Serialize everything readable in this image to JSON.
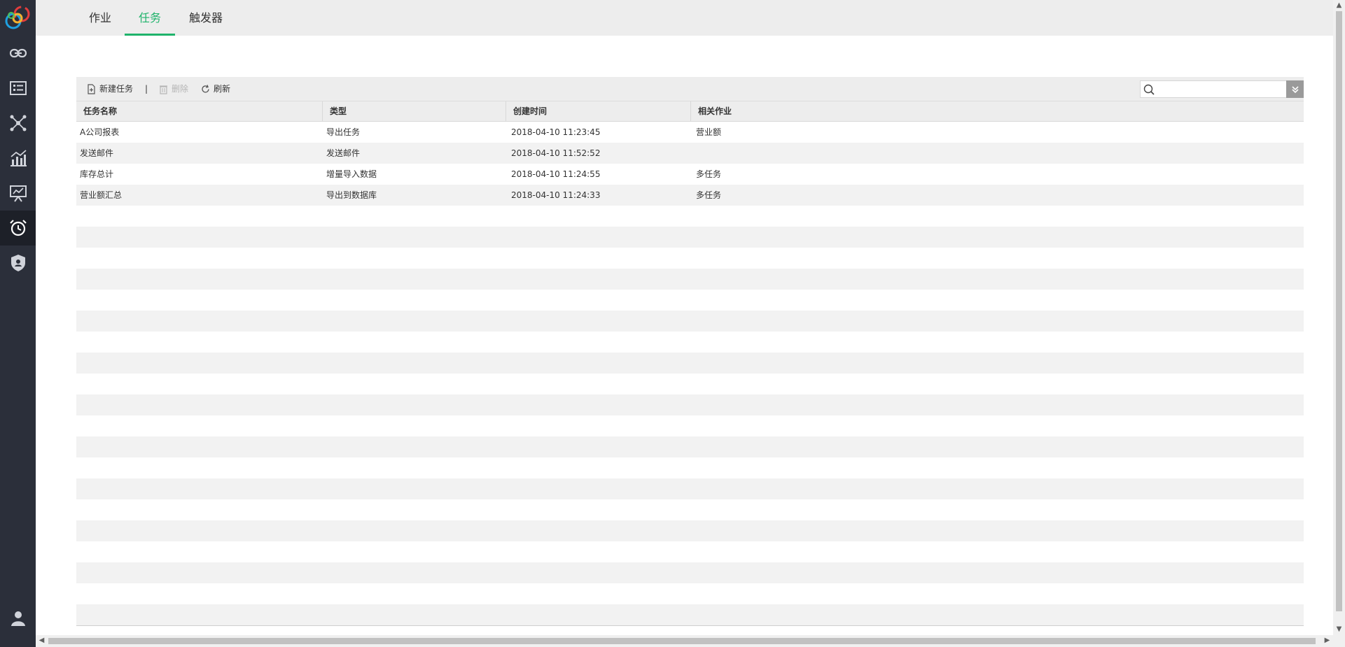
{
  "rail": {
    "items": [
      {
        "icon": "link-icon",
        "active": false
      },
      {
        "icon": "list-card-icon",
        "active": false
      },
      {
        "icon": "network-icon",
        "active": false
      },
      {
        "icon": "bar-chart-icon",
        "active": false
      },
      {
        "icon": "presentation-icon",
        "active": false
      },
      {
        "icon": "alarm-clock-icon",
        "active": true
      },
      {
        "icon": "shield-user-icon",
        "active": false
      }
    ],
    "bottom_icon": "user-icon"
  },
  "tabs": [
    {
      "label": "作业",
      "active": false
    },
    {
      "label": "任务",
      "active": true
    },
    {
      "label": "触发器",
      "active": false
    }
  ],
  "toolbar": {
    "new_label": "新建任务",
    "separator": "|",
    "delete_label": "删除",
    "refresh_label": "刷新",
    "search_placeholder": "",
    "search_value": ""
  },
  "table": {
    "columns": [
      "任务名称",
      "类型",
      "创建时间",
      "相关作业"
    ],
    "rows": [
      [
        "A公司报表",
        "导出任务",
        "2018-04-10 11:23:45",
        "营业额"
      ],
      [
        "发送邮件",
        "发送邮件",
        "2018-04-10 11:52:52",
        ""
      ],
      [
        "库存总计",
        "增量导入数据",
        "2018-04-10 11:24:55",
        "多任务"
      ],
      [
        "营业额汇总",
        "导出到数据库",
        "2018-04-10 11:24:33",
        "多任务"
      ]
    ]
  },
  "colors": {
    "accent": "#1fb36b",
    "rail_bg": "#2b2f3a",
    "rail_active": "#1d2028"
  }
}
